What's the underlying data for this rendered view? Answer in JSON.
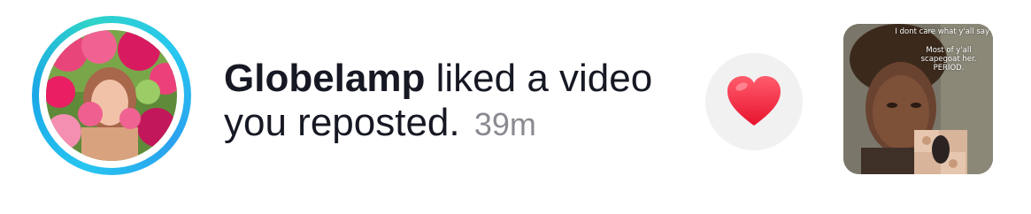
{
  "notification": {
    "username": "Globelamp",
    "action": " liked a video you reposted. ",
    "time": "39m"
  },
  "avatar": {
    "ring_color": "#27c6f0"
  },
  "heart": {
    "icon": "heart-icon",
    "color": "#fe2c55"
  },
  "thumbnail": {
    "caption_line1": "I dont care what y'all say",
    "caption_line2": "Most of y'all scapegoat her. PERIOD."
  }
}
